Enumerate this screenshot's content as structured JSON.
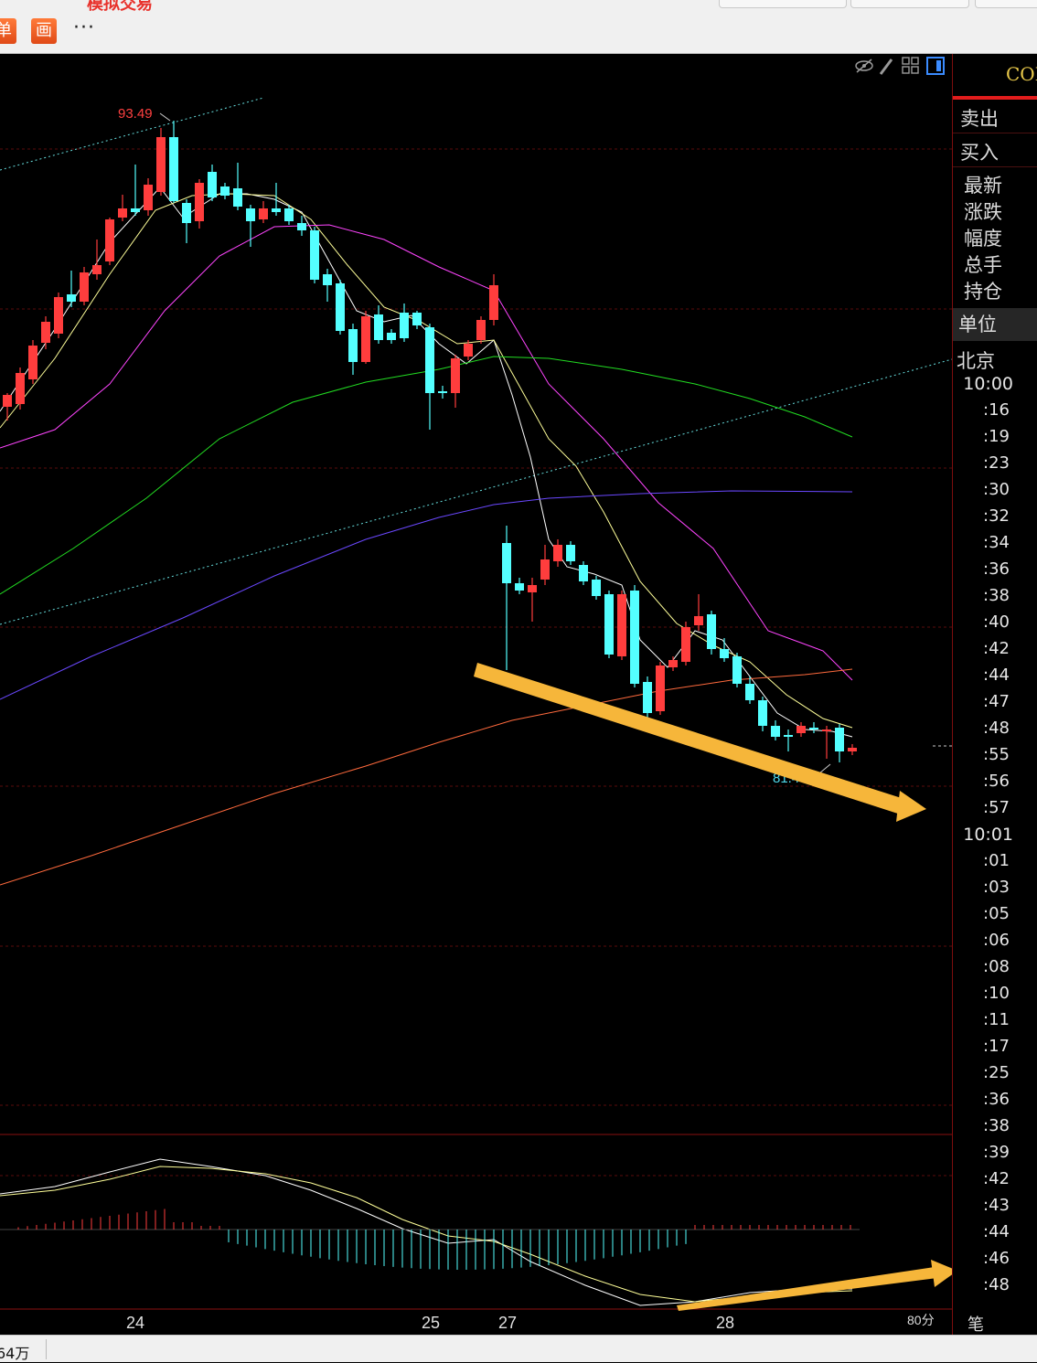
{
  "toolbar": {
    "title_fragment": "模拟交易",
    "btn_dan": "单",
    "btn_hua": "画",
    "more": "···"
  },
  "chart": {
    "high_label": "93.49",
    "low_label": "81.43",
    "x_labels": [
      {
        "text": "24"
      },
      {
        "text": "25"
      },
      {
        "text": "27"
      },
      {
        "text": "28"
      }
    ],
    "corner_label": "80分",
    "corner_label2": "笔",
    "colors": {
      "up": "#ff3d3d",
      "down": "#54ffff",
      "ma5": "#ffffff",
      "ma10": "#ffff99",
      "ma20": "#ff45ff",
      "ma40": "#22dd22",
      "ma60": "#6a48ff",
      "ma120": "#ff6a3d",
      "arrow": "#f6b63a"
    }
  },
  "chart_data": {
    "type": "candlestick",
    "high": 93.49,
    "low": 81.43,
    "dates": [
      "24",
      "25",
      "27",
      "28"
    ]
  },
  "panel": {
    "header": "CON",
    "sell": "卖出",
    "buy": "买入",
    "quote_labels": [
      "最新",
      "涨跌",
      "幅度",
      "总手",
      "持仓"
    ],
    "unit": "单位",
    "city": "北京",
    "times": [
      "10:00",
      ":16",
      ":19",
      ":23",
      ":30",
      ":32",
      ":34",
      ":36",
      ":38",
      ":40",
      ":42",
      ":44",
      ":47",
      ":48",
      ":55",
      ":56",
      ":57",
      "10:01",
      ":01",
      ":03",
      ":05",
      ":06",
      ":08",
      ":10",
      ":11",
      ":17",
      ":25",
      ":36",
      ":38",
      ":39",
      ":42",
      ":43",
      ":44",
      ":46",
      ":48"
    ]
  },
  "status": {
    "text": "64万"
  }
}
